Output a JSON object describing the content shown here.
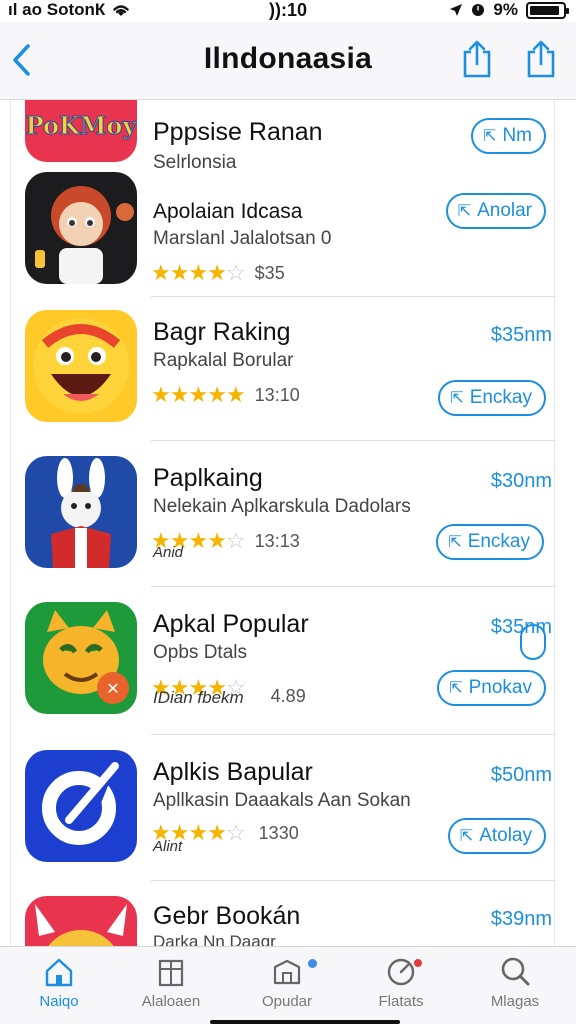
{
  "status": {
    "carrier": "ıl ao SotonК",
    "time": ")):10",
    "battery": "9%",
    "battery_level": 0.9
  },
  "nav": {
    "title": "Ilndonaasia",
    "back_icon": "chevron-left-icon",
    "share_icon": "share-icon"
  },
  "apps": [
    {
      "name": "Pppsise Ranan",
      "subtitle": "Selrlonsia",
      "button": "Nm",
      "icon_text": "PoKMoy",
      "colors": {
        "bg": "#e8344e",
        "accent": "#f5d23a"
      }
    },
    {
      "name": "Apolaian Idcasa",
      "subtitle": "Marslanl Jalalotsan 0",
      "rating": 4,
      "rating_count": "$35",
      "button": "Anolar",
      "colors": {
        "bg": "#1c1c1e",
        "accent": "#e8452c"
      }
    },
    {
      "name": "Bagr Raking",
      "subtitle": "Rapkalal Borular",
      "rating": 5,
      "rating_count": "13:10",
      "price": "$35nm",
      "button": "Enckay",
      "colors": {
        "bg": "#ffc928",
        "accent": "#e8452c"
      }
    },
    {
      "name": "Paplkaing",
      "subtitle": "Nelekain Aplkarskula Dadolars",
      "extra": "Anid",
      "rating": 4,
      "rating_count": "13:13",
      "price": "$30nm",
      "button": "Enckay",
      "colors": {
        "bg": "#1f4aa8",
        "accent": "#d12b2b"
      }
    },
    {
      "name": "Apkal Popular",
      "subtitle": "Opbs Dtals",
      "extra": "IDian fbekm",
      "rating": 4,
      "rating_count": "4.89",
      "price": "$35nm",
      "button": "Pnokav",
      "colors": {
        "bg": "#1f9a3a",
        "accent": "#f5b42a"
      }
    },
    {
      "name": "Aplkis Bapular",
      "subtitle": "Apllkasin Daaakals Aan Sokan",
      "extra": "Alint",
      "rating": 4,
      "rating_count": "1330",
      "price": "$50nm",
      "button": "Atolay",
      "colors": {
        "bg": "#1d3fcf",
        "accent": "#ffffff"
      }
    },
    {
      "name": "Gebr Bookán",
      "subtitle": "Darka Nn Daagr",
      "price": "$39nm",
      "colors": {
        "bg": "#e8344e",
        "accent": "#f5c23a"
      }
    }
  ],
  "tabs": [
    {
      "label": "Naiqo",
      "icon": "home-icon",
      "active": true
    },
    {
      "label": "Alaloaen",
      "icon": "apps-icon",
      "active": false
    },
    {
      "label": "Opudar",
      "icon": "box-icon",
      "active": false,
      "badge": true
    },
    {
      "label": "Flatats",
      "icon": "gauge-icon",
      "active": false,
      "badge": true
    },
    {
      "label": "Mlagas",
      "icon": "search-icon",
      "active": false
    }
  ],
  "accent_color": "#1c8fe0"
}
